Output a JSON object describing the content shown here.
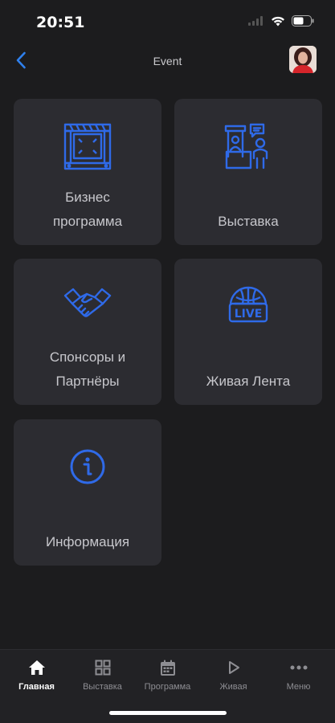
{
  "status_bar": {
    "time": "20:51"
  },
  "header": {
    "title": "Event"
  },
  "tiles": [
    {
      "label_line1": "Бизнес",
      "label_line2": "программа"
    },
    {
      "label": "Выставка"
    },
    {
      "label_line1": "Спонсоры и",
      "label_line2": "Партнёры"
    },
    {
      "label": "Живая Лента"
    },
    {
      "label": "Информация"
    }
  ],
  "tabbar": {
    "items": [
      {
        "label": "Главная",
        "icon": "home-icon",
        "active": true
      },
      {
        "label": "Выставка",
        "icon": "grid-icon"
      },
      {
        "label": "Программа",
        "icon": "calendar-icon"
      },
      {
        "label": "Живая",
        "icon": "play-icon"
      },
      {
        "label": "Меню",
        "icon": "more-icon"
      }
    ]
  },
  "colors": {
    "background": "#1c1c1e",
    "tile": "#2c2c31",
    "accent_icon": "#2f6ae8",
    "back_arrow": "#2f80ed"
  }
}
